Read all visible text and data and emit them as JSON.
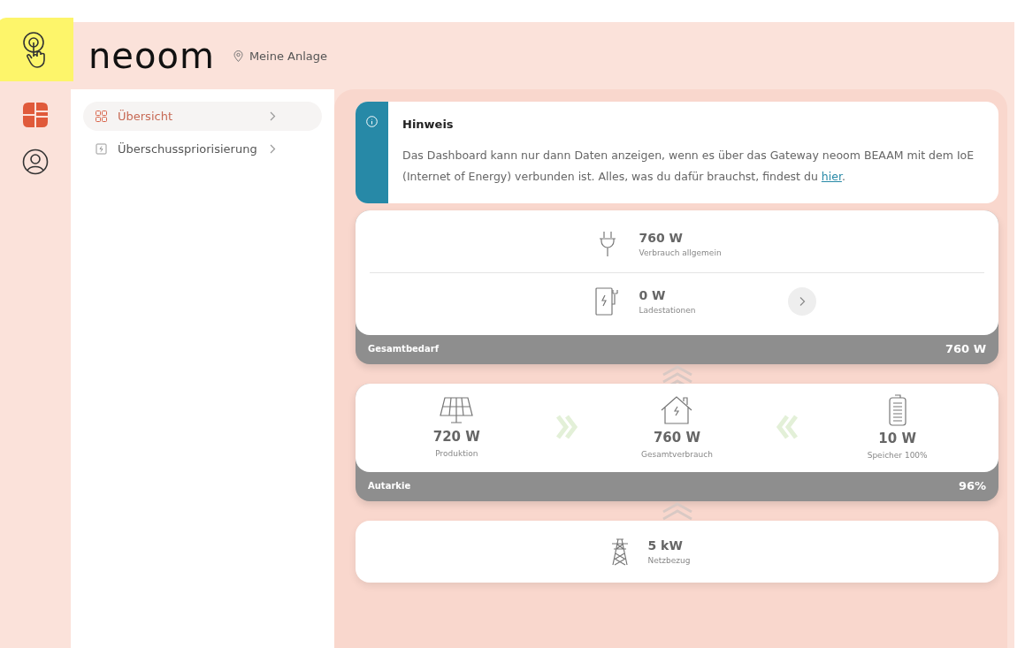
{
  "header": {
    "logo": "neoom",
    "location": "Meine Anlage"
  },
  "rail": [
    {
      "kind": "tap",
      "selected": false
    },
    {
      "kind": "dashboard",
      "selected": true
    },
    {
      "kind": "profile",
      "selected": false
    }
  ],
  "sidebar": {
    "items": [
      {
        "kind": "grid",
        "label": "Übersicht",
        "selected": true
      },
      {
        "kind": "priority",
        "label": "Überschusspriorisierung",
        "selected": false
      }
    ]
  },
  "notice": {
    "title": "Hinweis",
    "text": "Das Dashboard kann nur dann Daten anzeigen, wenn es über das Gateway neoom BEAAM mit dem IoE (Internet of Energy) verbunden ist. Alles, was du dafür brauchst, findest du ",
    "link": "hier",
    "after": "."
  },
  "demand": {
    "rows": [
      {
        "kind": "plug",
        "value": "760 W",
        "label": "Verbrauch allgemein",
        "action": false
      },
      {
        "kind": "charger",
        "value": "0 W",
        "label": "Ladestationen",
        "action": true
      }
    ],
    "footer_label": "Gesamtbedarf",
    "footer_value": "760 W"
  },
  "balance": {
    "items": [
      {
        "kind": "solar",
        "value": "720 W",
        "label": "Produktion"
      },
      {
        "kind": "house",
        "value": "760 W",
        "label": "Gesamtverbrauch"
      },
      {
        "kind": "battery",
        "value": "10 W",
        "label": "Speicher 100%"
      }
    ],
    "footer_label": "Autarkie",
    "footer_value": "96%"
  },
  "grid": {
    "value": "5 kW",
    "label": "Netzbezug"
  }
}
